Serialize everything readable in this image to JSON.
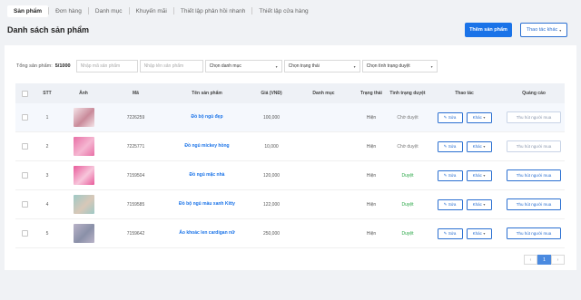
{
  "tabs": [
    {
      "label": "Sản phẩm",
      "active": true
    },
    {
      "label": "Đơn hàng",
      "active": false
    },
    {
      "label": "Danh mục",
      "active": false
    },
    {
      "label": "Khuyến mãi",
      "active": false
    },
    {
      "label": "Thiết lập phản hồi nhanh",
      "active": false
    },
    {
      "label": "Thiết lập cửa hàng",
      "active": false
    }
  ],
  "page_title": "Danh sách sản phẩm",
  "buttons": {
    "add": "Thêm sản phẩm",
    "more": "Thao tác khác"
  },
  "filters": {
    "total_label": "Tổng sản phẩm:",
    "total_value": "5/1000",
    "code_placeholder": "Nhập mã sản phẩm",
    "name_placeholder": "Nhập tên sản phẩm",
    "category": "Chọn danh mục",
    "status": "Chọn trạng thái",
    "approval": "Chọn tình trạng duyệt"
  },
  "columns": [
    "STT",
    "Ảnh",
    "Mã",
    "Tên sản phẩm",
    "Giá (VNĐ)",
    "Danh mục",
    "Trạng thái",
    "Tình trạng duyệt",
    "Thao tác",
    "Quảng cáo"
  ],
  "rows": [
    {
      "stt": "1",
      "code": "7226259",
      "name": "Đồ bộ ngủ đẹp",
      "price": "100,000",
      "category": "",
      "state": "Hiện",
      "approval": "Chờ duyệt",
      "approval_ok": false,
      "img": [
        "#f4e4e8",
        "#c98a9a"
      ]
    },
    {
      "stt": "2",
      "code": "7225771",
      "name": "Đồ ngủ mickey hồng",
      "price": "10,000",
      "category": "",
      "state": "Hiện",
      "approval": "Chờ duyệt",
      "approval_ok": false,
      "img": [
        "#e86fa6",
        "#f5b7d2"
      ]
    },
    {
      "stt": "3",
      "code": "7159504",
      "name": "Đồ ngủ mặc nhà",
      "price": "120,000",
      "category": "",
      "state": "Hiện",
      "approval": "Duyệt",
      "approval_ok": true,
      "img": [
        "#e85a9a",
        "#f7c6db"
      ]
    },
    {
      "stt": "4",
      "code": "7159585",
      "name": "Đồ bộ ngủ màu xanh Kitty",
      "price": "122,000",
      "category": "",
      "state": "Hiện",
      "approval": "Duyệt",
      "approval_ok": true,
      "img": [
        "#9ec9c6",
        "#d8c8b8"
      ]
    },
    {
      "stt": "5",
      "code": "7159642",
      "name": "Áo khoác len cardigan nữ",
      "price": "250,000",
      "category": "",
      "state": "Hiện",
      "approval": "Duyệt",
      "approval_ok": true,
      "img": [
        "#b9b3c8",
        "#8a90a8"
      ]
    }
  ],
  "actions": {
    "edit": "Sửa",
    "extra": "Khác",
    "ads": "Thu hút người mua"
  },
  "pagination": {
    "prev": "‹",
    "current": "1",
    "next": "›"
  },
  "colors": {
    "primary": "#1a73e8",
    "approved": "#28a745"
  }
}
